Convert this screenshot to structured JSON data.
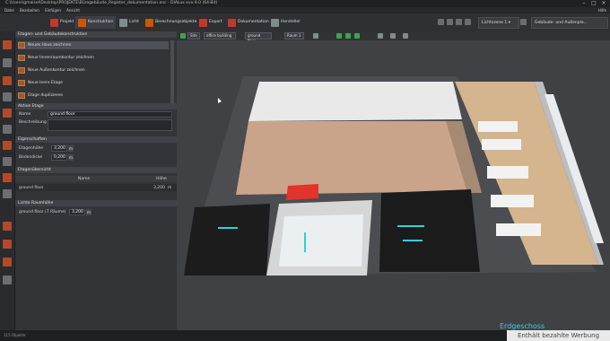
{
  "titlebar": {
    "title": "C:\\Users\\gmaisel\\Desktop\\PROJEKTE\\Bürogebäude_Register_dokumentation.enc - DIALux evo 9.0 (64-Bit)"
  },
  "menubar": {
    "items": [
      "Datei",
      "Bearbeiten",
      "Einfügen",
      "Ansicht"
    ],
    "right": "Hilfe"
  },
  "ribbon": {
    "tabs": [
      {
        "label": "Projekt",
        "icon": "project-icon"
      },
      {
        "label": "Konstruktion",
        "icon": "construction-icon"
      },
      {
        "label": "Licht",
        "icon": "light-icon"
      },
      {
        "label": "Berechnungsobjekte",
        "icon": "calc-objects-icon"
      },
      {
        "label": "Export",
        "icon": "export-icon"
      },
      {
        "label": "Dokumentation",
        "icon": "documentation-icon"
      },
      {
        "label": "Hersteller",
        "icon": "manufacturer-icon"
      }
    ],
    "lightscene": "Lichtszene 1",
    "view_select": "Gebäude- und Außenpla..."
  },
  "panel": {
    "header": "Etagen- und Gebäudekonstruktion",
    "actions": [
      "Neues Haus zeichnen",
      "Neue Innenraumkontur zeichnen",
      "Neue Außenkontur zeichnen",
      "Neue leere Etage",
      "Etage duplizieren"
    ],
    "active_floor_header": "Aktive Etage",
    "name_label": "Name",
    "name_value": "ground floor",
    "desc_label": "Beschreibung",
    "props_header": "Eigenschaften",
    "height_label": "Etagenhöhe",
    "height_value": "3,200",
    "height_unit": "m",
    "thickness_label": "Bodendicke",
    "thickness_value": "0,200",
    "thickness_unit": "m",
    "overview_header": "Etagenübersicht",
    "col_name": "Name",
    "col_height": "Höhe",
    "row_name": "ground floor",
    "row_height": "3,200",
    "row_unit": "m",
    "clear_header": "Lichte Raumhöhe",
    "clear_name": "ground floor (7 Räume)",
    "clear_value": "3,200",
    "clear_unit": "m"
  },
  "viewport": {
    "crumbs": [
      "Site",
      "office building",
      "ground floor",
      "Raum 1"
    ],
    "floor_label": "Erdgeschoss"
  },
  "status": {
    "left": "115 Objekte",
    "ad": "Enthält bezahlte Werbung"
  },
  "colors": {
    "accent": "#d9532b",
    "floor": "#d8b48a",
    "dark_room": "#1a1a1a"
  }
}
